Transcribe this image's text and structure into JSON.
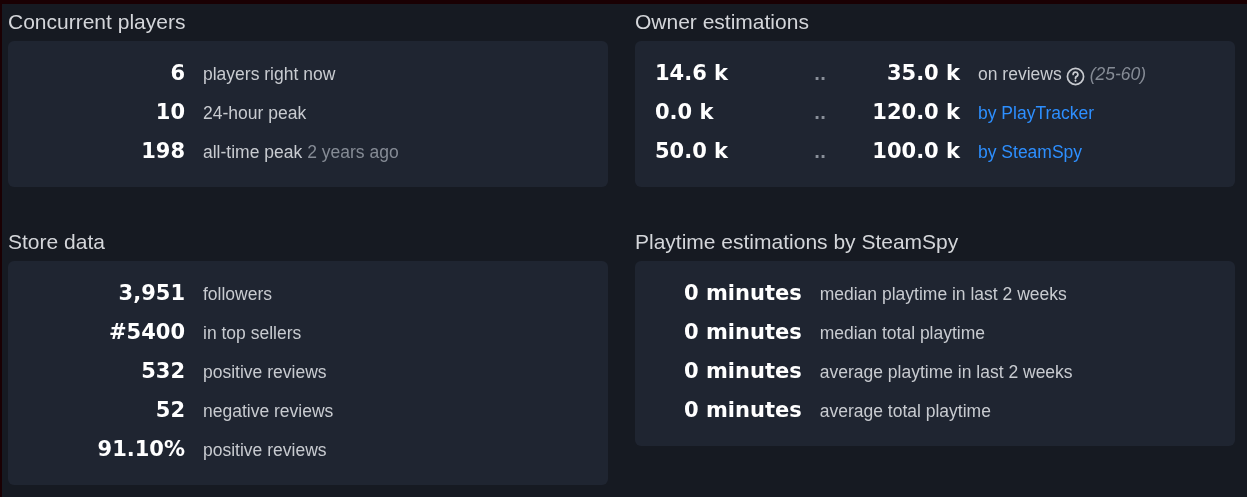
{
  "concurrent_players": {
    "title": "Concurrent players",
    "rows": [
      {
        "value": "6",
        "label": "players right now"
      },
      {
        "value": "10",
        "label": "24-hour peak"
      },
      {
        "value": "198",
        "label": "all-time peak",
        "note": "2 years ago"
      }
    ]
  },
  "owner_estimations": {
    "title": "Owner estimations",
    "rows": [
      {
        "low": "14.6 k",
        "separator": "..",
        "high": "35.0 k",
        "label": "on reviews",
        "kind": "text",
        "help": true,
        "note": "(25-60)"
      },
      {
        "low": "0.0 k",
        "separator": "..",
        "high": "120.0 k",
        "label": "by PlayTracker",
        "kind": "link",
        "help": false
      },
      {
        "low": "50.0 k",
        "separator": "..",
        "high": "100.0 k",
        "label": "by SteamSpy",
        "kind": "link",
        "help": false
      }
    ]
  },
  "store_data": {
    "title": "Store data",
    "rows": [
      {
        "value": "3,951",
        "label": "followers"
      },
      {
        "value": "#5400",
        "label": "in top sellers"
      },
      {
        "value": "532",
        "label": "positive reviews"
      },
      {
        "value": "52",
        "label": "negative reviews"
      },
      {
        "value": "91.10%",
        "label": "positive reviews"
      }
    ]
  },
  "playtime": {
    "title": "Playtime estimations by SteamSpy",
    "rows": [
      {
        "value": "0 minutes",
        "label": "median playtime in last 2 weeks"
      },
      {
        "value": "0 minutes",
        "label": "median total playtime"
      },
      {
        "value": "0 minutes",
        "label": "average playtime in last 2 weeks"
      },
      {
        "value": "0 minutes",
        "label": "average total playtime"
      }
    ]
  }
}
